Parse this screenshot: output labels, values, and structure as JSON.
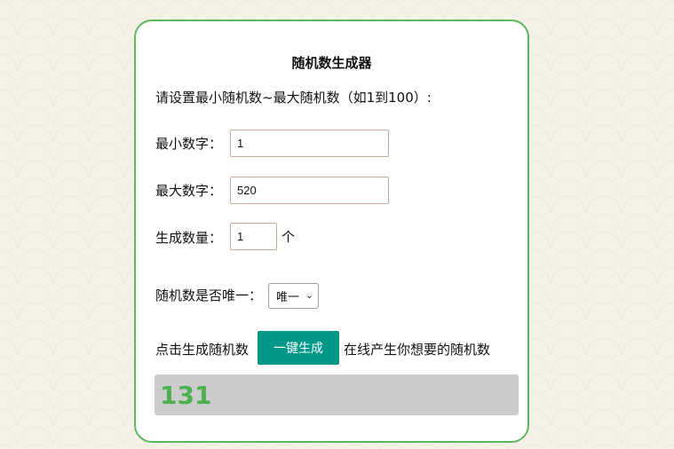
{
  "page": {
    "title": "随机数生成器",
    "instruction": "请设置最小随机数~最大随机数（如1到100）:"
  },
  "form": {
    "min_label": "最小数字：",
    "min_value": "1",
    "max_label": "最大数字：",
    "max_value": "520",
    "count_label": "生成数量：",
    "count_value": "1",
    "count_unit": "个",
    "unique_label": "随机数是否唯一：",
    "unique_selected": "唯一"
  },
  "generate": {
    "prefix": "点击生成随机数",
    "button_label": "一键生成",
    "suffix": "在线产生你想要的随机数"
  },
  "result": {
    "value": "131"
  },
  "colors": {
    "accent": "#009688",
    "border": "#5cb85c",
    "result_text": "#4caf50"
  }
}
